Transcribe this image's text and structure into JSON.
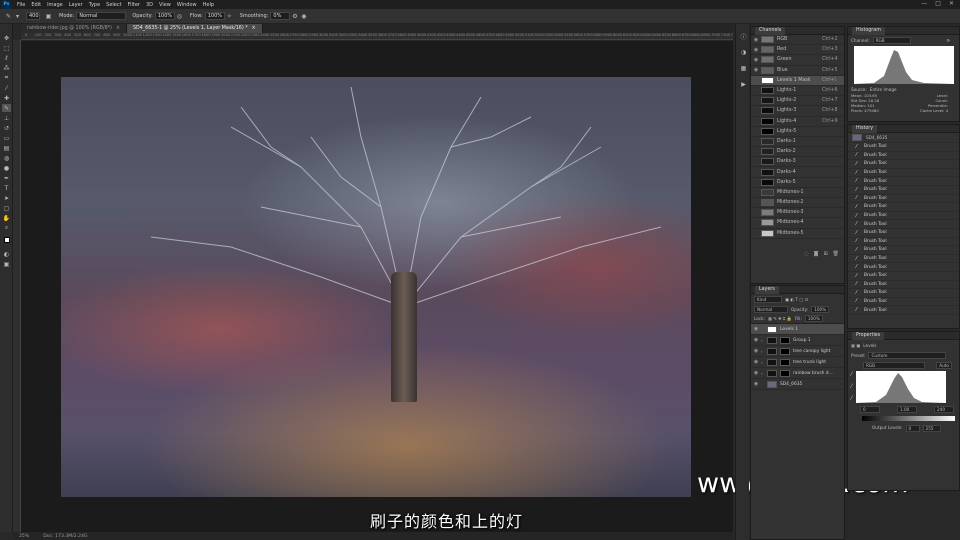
{
  "app": {
    "logo": "Ps"
  },
  "menu": [
    "File",
    "Edit",
    "Image",
    "Layer",
    "Type",
    "Select",
    "Filter",
    "3D",
    "View",
    "Window",
    "Help"
  ],
  "window_controls": [
    "—",
    "□",
    "✕"
  ],
  "options": {
    "size_value": "400",
    "mode_label": "Mode:",
    "mode_value": "Normal",
    "opacity_label": "Opacity:",
    "opacity_value": "100%",
    "flow_label": "Flow:",
    "flow_value": "100%",
    "smoothing_label": "Smoothing:",
    "smoothing_value": "0%"
  },
  "tabs": [
    {
      "label": "rainbow-rider.jpg @ 100% (RGB/8*)",
      "close": "×"
    },
    {
      "label": "SD4_6635-1 @ 25% (Levels 1, Layer Mask/16) *",
      "close": "×"
    }
  ],
  "ruler_top": [
    "0",
    "100",
    "200",
    "300",
    "400",
    "500",
    "600",
    "700",
    "800",
    "900",
    "1000",
    "1100",
    "1200",
    "1300",
    "1400",
    "1500",
    "1600",
    "1700",
    "1800",
    "1900",
    "2000",
    "2100",
    "2200",
    "2300",
    "2400",
    "2500",
    "2600",
    "2700",
    "2800",
    "2900",
    "3000",
    "3100",
    "3200",
    "3300",
    "3400",
    "3500",
    "3600",
    "3700",
    "3800",
    "3900",
    "4000",
    "4100",
    "4200",
    "4300",
    "4400",
    "4500",
    "4600",
    "4700",
    "4800",
    "4900",
    "5000",
    "5100",
    "5200",
    "5300",
    "5400",
    "5500",
    "5600",
    "5700",
    "5800",
    "5900",
    "6000",
    "6100",
    "6200",
    "6300",
    "6400",
    "6500",
    "6600",
    "6700",
    "6800",
    "6900",
    "7000",
    "7100",
    "7200"
  ],
  "status": {
    "zoom": "25%",
    "doc": "Doc: 173.3M/2.24G"
  },
  "subtitle": "刷子的颜色和上的灯",
  "watermark": "www.hunls.com",
  "channels": {
    "title": "Channels",
    "rows": [
      {
        "name": "RGB",
        "key": "Ctrl+2",
        "sel": false
      },
      {
        "name": "Red",
        "key": "Ctrl+3",
        "sel": false
      },
      {
        "name": "Green",
        "key": "Ctrl+4",
        "sel": false
      },
      {
        "name": "Blue",
        "key": "Ctrl+5",
        "sel": false
      },
      {
        "name": "Levels 1 Mask",
        "key": "Ctrl+\\",
        "sel": true
      },
      {
        "name": "Lights-1",
        "key": "Ctrl+6",
        "sel": false
      },
      {
        "name": "Lights-2",
        "key": "Ctrl+7",
        "sel": false
      },
      {
        "name": "Lights-3",
        "key": "Ctrl+8",
        "sel": false
      },
      {
        "name": "Lights-4",
        "key": "Ctrl+9",
        "sel": false
      },
      {
        "name": "Lights-5",
        "key": "",
        "sel": false
      },
      {
        "name": "Darks-1",
        "key": "",
        "sel": false
      },
      {
        "name": "Darks-2",
        "key": "",
        "sel": false
      },
      {
        "name": "Darks-3",
        "key": "",
        "sel": false
      },
      {
        "name": "Darks-4",
        "key": "",
        "sel": false
      },
      {
        "name": "Darks-5",
        "key": "",
        "sel": false
      },
      {
        "name": "Midtones-1",
        "key": "",
        "sel": false
      },
      {
        "name": "Midtones-2",
        "key": "",
        "sel": false
      },
      {
        "name": "Midtones-3",
        "key": "",
        "sel": false
      },
      {
        "name": "Midtones-4",
        "key": "",
        "sel": false
      },
      {
        "name": "Midtones-5",
        "key": "",
        "sel": false
      }
    ]
  },
  "layers": {
    "title": "Layers",
    "kind_label": "Kind",
    "blend": "Normal",
    "opacity_label": "Opacity:",
    "opacity_value": "100%",
    "lock_label": "Lock:",
    "fill_label": "Fill:",
    "fill_value": "100%",
    "rows": [
      {
        "name": "Levels 1",
        "sel": true
      },
      {
        "name": "Group 1",
        "sel": false
      },
      {
        "name": "tree canopy light",
        "sel": false
      },
      {
        "name": "tree trunk light",
        "sel": false
      },
      {
        "name": "rainbow brush d...",
        "sel": false
      },
      {
        "name": "SD4_6635",
        "sel": false
      }
    ]
  },
  "histogram": {
    "title": "Histogram",
    "channel_label": "Channel:",
    "channel_value": "RGB",
    "source_label": "Source:",
    "source_value": "Entire Image",
    "stats_left": [
      "Mean: 103.65",
      "Std Dev: 28.28",
      "Median: 101",
      "Pixels: 479480"
    ],
    "stats_right": [
      "Level:",
      "Count:",
      "Percentile:",
      "Cache Level: 4"
    ]
  },
  "history": {
    "title": "History",
    "snapshot": "SD4_6635",
    "item": "Brush Tool",
    "count": 20
  },
  "properties": {
    "title": "Properties",
    "type": "Levels",
    "preset_label": "Preset:",
    "preset_value": "Custom",
    "channel_value": "RGB",
    "auto": "Auto",
    "input_values": [
      "0",
      "1.00",
      "240"
    ],
    "output_label": "Output Levels:",
    "output_values": [
      "0",
      "255"
    ]
  }
}
